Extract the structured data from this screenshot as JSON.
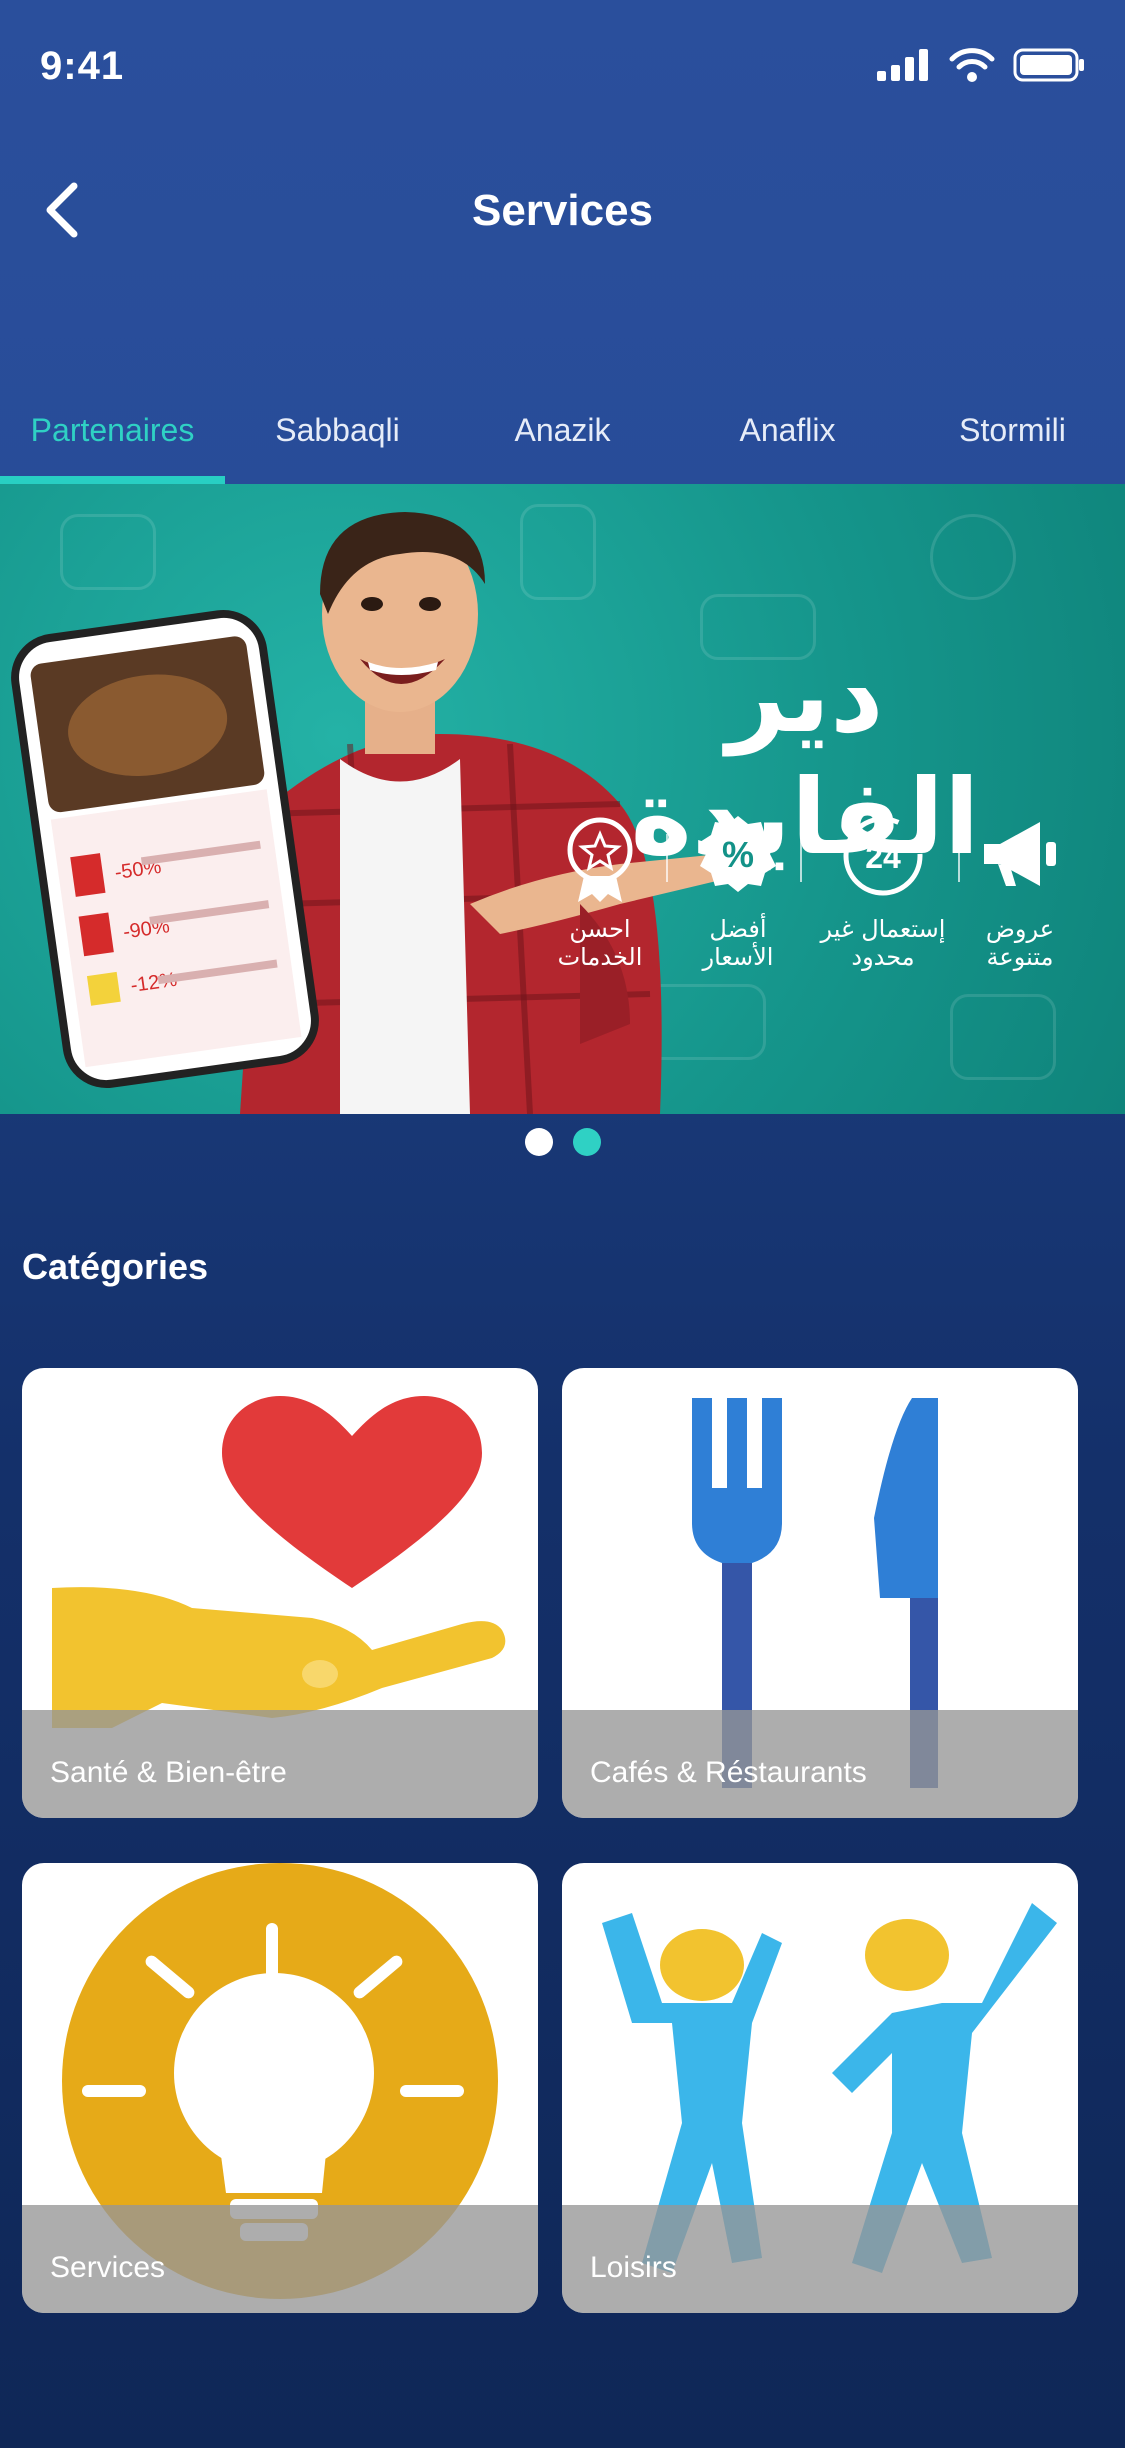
{
  "status": {
    "time": "9:41"
  },
  "header": {
    "title": "Services"
  },
  "tabs": [
    {
      "label": "Partenaires",
      "active": true
    },
    {
      "label": "Sabbaqli"
    },
    {
      "label": "Anazik"
    },
    {
      "label": "Anaflix"
    },
    {
      "label": "Stormili"
    }
  ],
  "banner": {
    "headline": "دير الفايدة",
    "features": [
      {
        "text": "عروض متنوعة",
        "icon": "megaphone-icon"
      },
      {
        "text": "إستعمال غير محدود",
        "icon": "24-hours-icon"
      },
      {
        "text": "أفضل الأسعار",
        "icon": "percent-badge-icon"
      },
      {
        "text": "احسن الخدمات",
        "icon": "star-medal-icon"
      }
    ],
    "phone_badges": [
      "-50%",
      "-90%",
      "-12%"
    ]
  },
  "carousel": {
    "count": 2,
    "active_index": 1
  },
  "categories": {
    "title": "Catégories",
    "items": [
      {
        "label": "Santé & Bien-être",
        "icon": "heart-hand-icon"
      },
      {
        "label": "Cafés & Réstaurants",
        "icon": "fork-knife-icon"
      },
      {
        "label": "Services",
        "icon": "lightbulb-icon"
      },
      {
        "label": "Loisirs",
        "icon": "dancing-people-icon"
      }
    ]
  },
  "colors": {
    "accent": "#2fd1c4",
    "background_top": "#2a4f9c",
    "background_bottom": "#0f2757"
  }
}
